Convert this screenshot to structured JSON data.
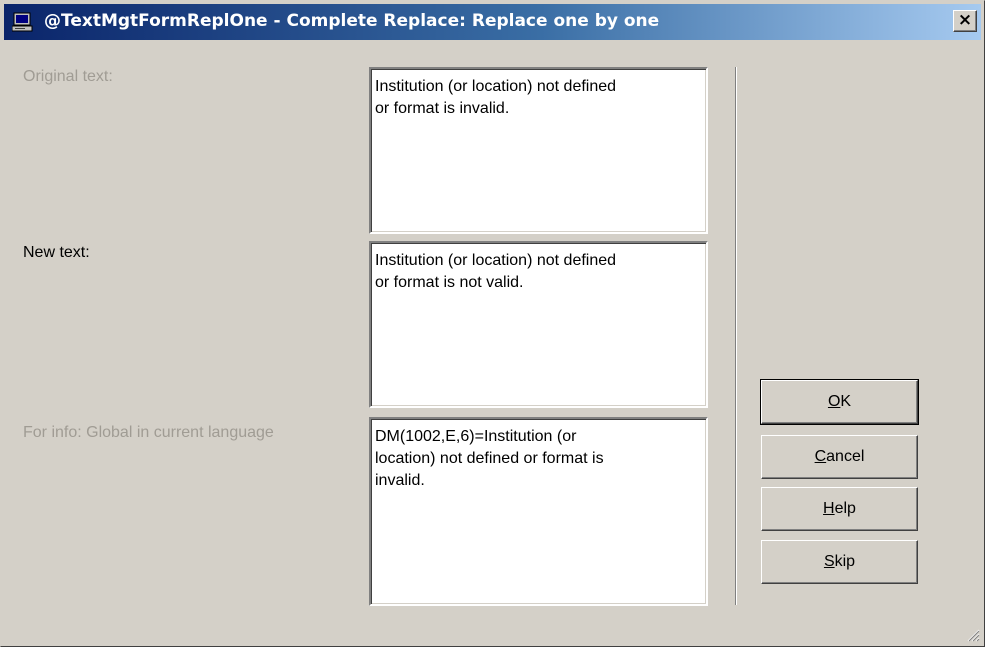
{
  "window": {
    "title": "@TextMgtFormReplOne - Complete Replace: Replace one by one",
    "close_glyph": "×",
    "icon": "computer-icon"
  },
  "fields": {
    "original_label": "Original text:",
    "original_value": "Institution (or location) not defined\nor format is invalid.",
    "new_label": "New text:",
    "new_value": "Institution (or location) not defined\nor format is not valid.",
    "info_label": "For info: Global in current language",
    "info_value": "DM(1002,E,6)=Institution (or\nlocation) not defined or format is\ninvalid."
  },
  "buttons": {
    "ok": {
      "first": "O",
      "rest": "K"
    },
    "cancel": {
      "first": "C",
      "rest": "ancel"
    },
    "help": {
      "first": "H",
      "rest": "elp"
    },
    "skip": {
      "first": "S",
      "rest": "kip"
    }
  },
  "colors": {
    "face": "#d4d0c8",
    "title_start": "#0a246a",
    "title_end": "#a6caf0",
    "disabled_text": "#a09c94"
  }
}
